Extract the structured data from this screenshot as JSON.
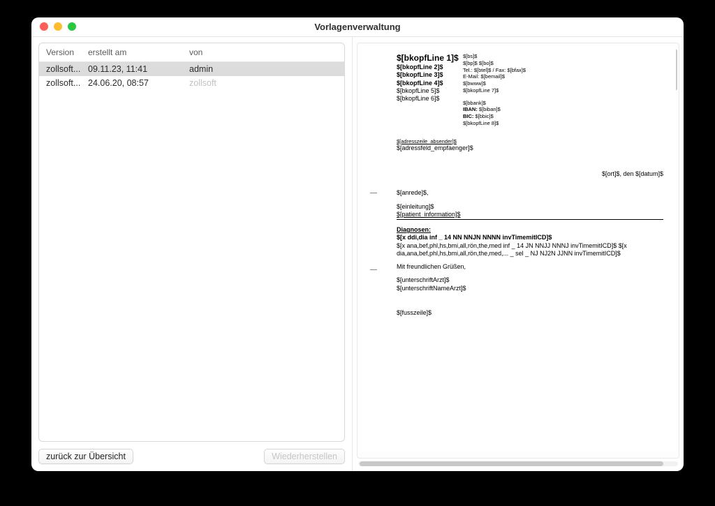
{
  "window": {
    "title": "Vorlagenverwaltung"
  },
  "list": {
    "headers": {
      "version": "Version",
      "created": "erstellt am",
      "by": "von"
    },
    "rows": [
      {
        "version": "zollsoft...",
        "created": "09.11.23, 11:41",
        "by": "admin",
        "selected": true
      },
      {
        "version": "zollsoft...",
        "created": "24.06.20, 08:57",
        "by": "zollsoft",
        "byMuted": true
      }
    ]
  },
  "buttons": {
    "back": "zurück zur Übersicht",
    "restore": "Wiederherstellen"
  },
  "doc": {
    "headLeft": [
      {
        "t": "$[bkopfLine 1]$",
        "big": true,
        "b": true
      },
      {
        "t": "$[bkopfLine 2]$",
        "b": true
      },
      {
        "t": "$[bkopfLine 3]$",
        "b": true
      },
      {
        "t": "$[bkopfLine 4]$",
        "b": true
      },
      {
        "t": "$[bkopfLine 5]$"
      },
      {
        "t": "$[bkopfLine 6]$"
      }
    ],
    "headRight1": [
      {
        "t": "$[bs]$"
      },
      {
        "t": "$[bp]$ $[bo]$"
      },
      {
        "t": "Tel.: $[btel]$ / Fax: $[bfax]$"
      },
      {
        "t": "E-Mail: $[bemail]$"
      },
      {
        "t": "$[bwww]$"
      },
      {
        "t": "$[bkopfLine 7]$"
      }
    ],
    "headRight2": [
      {
        "t": "$[bbank]$"
      },
      {
        "t": "IBAN: $[biban]$",
        "prefixBold": "IBAN:"
      },
      {
        "t": "BIC: $[bbic]$",
        "prefixBold": "BIC:"
      },
      {
        "t": "$[bkopfLine 8]$"
      }
    ],
    "senderLine": "$[adresszeile_absender]$",
    "recipientField": "$[adressfeld_empfaenger]$",
    "dateLine": "$[ort]$, den $[datum]$",
    "salutation": "$[anrede]$,",
    "introLines": [
      "$[einleitung]$",
      "$[patient_information]$"
    ],
    "diagnosesHeading": "Diagnosen:",
    "diag1": "$[x ddi,dia inf _ 14 NN NNJN NNNN invTimemitICD]$",
    "diag2": "$[x ana,bef,phl,hs,bmi,all,rön,the,med inf _ 14 JN NNJJ NNNJ invTimemitICD]$ $[x dia,ana,bef,phl,hs,bmi,all,rön,the,med,... _ sel _ NJ NJ2N JJNN invTimemitICD]$",
    "closing": "Mit freundlichen Grüßen,",
    "sign1": "$[unterschriftArzt]$",
    "sign2": "$[unterschriftNameArzt]$",
    "footer": "$[fusszeile]$"
  }
}
